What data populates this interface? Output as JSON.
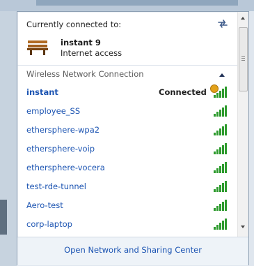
{
  "current": {
    "title": "Currently connected to:",
    "network_name": "instant  9",
    "status": "Internet access",
    "icons": {
      "refresh": "refresh-icon",
      "network": "bench-icon"
    }
  },
  "section": {
    "label": "Wireless Network Connection",
    "collapse_icon": "chevron-up-icon"
  },
  "networks": [
    {
      "name": "instant",
      "status": "Connected",
      "connected": true
    },
    {
      "name": "employee_SS",
      "status": "",
      "connected": false
    },
    {
      "name": "ethersphere-wpa2",
      "status": "",
      "connected": false
    },
    {
      "name": "ethersphere-voip",
      "status": "",
      "connected": false
    },
    {
      "name": "ethersphere-vocera",
      "status": "",
      "connected": false
    },
    {
      "name": "test-rde-tunnel",
      "status": "",
      "connected": false
    },
    {
      "name": "Aero-test",
      "status": "",
      "connected": false
    },
    {
      "name": "corp-laptop",
      "status": "",
      "connected": false
    }
  ],
  "footer": {
    "link": "Open Network and Sharing Center"
  },
  "colors": {
    "link": "#1c54b2",
    "signal": "#2e9b2e",
    "footer_bg": "#eef3f8"
  }
}
